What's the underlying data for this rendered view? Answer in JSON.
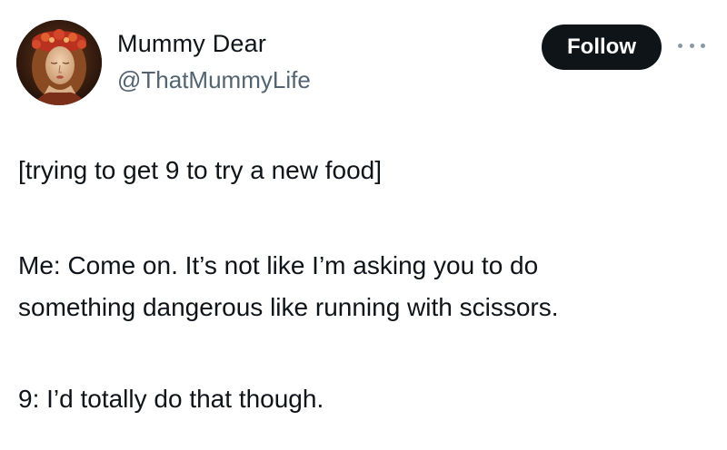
{
  "author": {
    "display_name": "Mummy Dear",
    "handle": "@ThatMummyLife"
  },
  "actions": {
    "follow_label": "Follow",
    "more_icon": "more-horizontal-icon"
  },
  "tweet": {
    "lines": [
      "[trying to get 9 to try a new food]",
      "Me: Come on. It’s not like I’m asking you to do",
      "something dangerous like running with scissors.",
      "9: I’d totally do that though."
    ]
  },
  "colors": {
    "text": "#0f1419",
    "secondary_text": "#536471",
    "follow_background": "#0f1419",
    "follow_text": "#ffffff"
  }
}
